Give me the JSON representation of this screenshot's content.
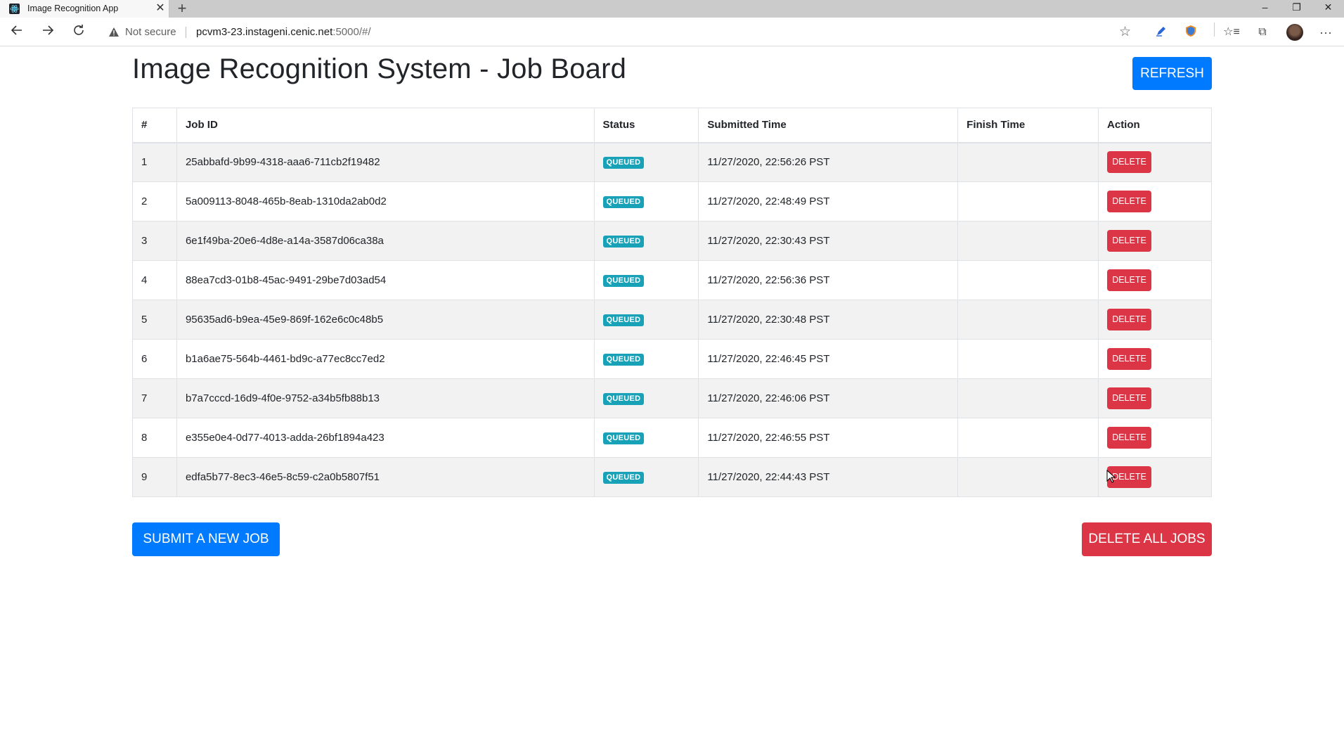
{
  "browser": {
    "tab_title": "Image Recognition App",
    "not_secure": "Not secure",
    "url_host": "pcvm3-23.instageni.cenic.net",
    "url_rest": ":5000/#/",
    "icons": [
      "back-arrow-icon",
      "forward-arrow-icon",
      "reload-icon",
      "warning-icon",
      "star-icon",
      "pen-icon",
      "shield-icon",
      "favorites-icon",
      "collections-icon",
      "more-icon"
    ]
  },
  "page": {
    "title": "Image Recognition System - Job Board",
    "refresh_label": "REFRESH",
    "submit_label": "SUBMIT A NEW JOB",
    "delete_all_label": "DELETE ALL JOBS"
  },
  "table": {
    "headers": [
      "#",
      "Job ID",
      "Status",
      "Submitted Time",
      "Finish Time",
      "Action"
    ],
    "rows": [
      {
        "num": "1",
        "job_id": "25abbafd-9b99-4318-aaa6-711cb2f19482",
        "status": "QUEUED",
        "submitted": "11/27/2020, 22:56:26 PST",
        "finished": "",
        "action": "DELETE"
      },
      {
        "num": "2",
        "job_id": "5a009113-8048-465b-8eab-1310da2ab0d2",
        "status": "QUEUED",
        "submitted": "11/27/2020, 22:48:49 PST",
        "finished": "",
        "action": "DELETE"
      },
      {
        "num": "3",
        "job_id": "6e1f49ba-20e6-4d8e-a14a-3587d06ca38a",
        "status": "QUEUED",
        "submitted": "11/27/2020, 22:30:43 PST",
        "finished": "",
        "action": "DELETE"
      },
      {
        "num": "4",
        "job_id": "88ea7cd3-01b8-45ac-9491-29be7d03ad54",
        "status": "QUEUED",
        "submitted": "11/27/2020, 22:56:36 PST",
        "finished": "",
        "action": "DELETE"
      },
      {
        "num": "5",
        "job_id": "95635ad6-b9ea-45e9-869f-162e6c0c48b5",
        "status": "QUEUED",
        "submitted": "11/27/2020, 22:30:48 PST",
        "finished": "",
        "action": "DELETE"
      },
      {
        "num": "6",
        "job_id": "b1a6ae75-564b-4461-bd9c-a77ec8cc7ed2",
        "status": "QUEUED",
        "submitted": "11/27/2020, 22:46:45 PST",
        "finished": "",
        "action": "DELETE"
      },
      {
        "num": "7",
        "job_id": "b7a7cccd-16d9-4f0e-9752-a34b5fb88b13",
        "status": "QUEUED",
        "submitted": "11/27/2020, 22:46:06 PST",
        "finished": "",
        "action": "DELETE"
      },
      {
        "num": "8",
        "job_id": "e355e0e4-0d77-4013-adda-26bf1894a423",
        "status": "QUEUED",
        "submitted": "11/27/2020, 22:46:55 PST",
        "finished": "",
        "action": "DELETE"
      },
      {
        "num": "9",
        "job_id": "edfa5b77-8ec3-46e5-8c59-c2a0b5807f51",
        "status": "QUEUED",
        "submitted": "11/27/2020, 22:44:43 PST",
        "finished": "",
        "action": "DELETE"
      }
    ]
  },
  "colors": {
    "primary": "#007bff",
    "danger": "#dc3545",
    "badge": "#17a2b8",
    "stripe": "#f2f2f2"
  }
}
